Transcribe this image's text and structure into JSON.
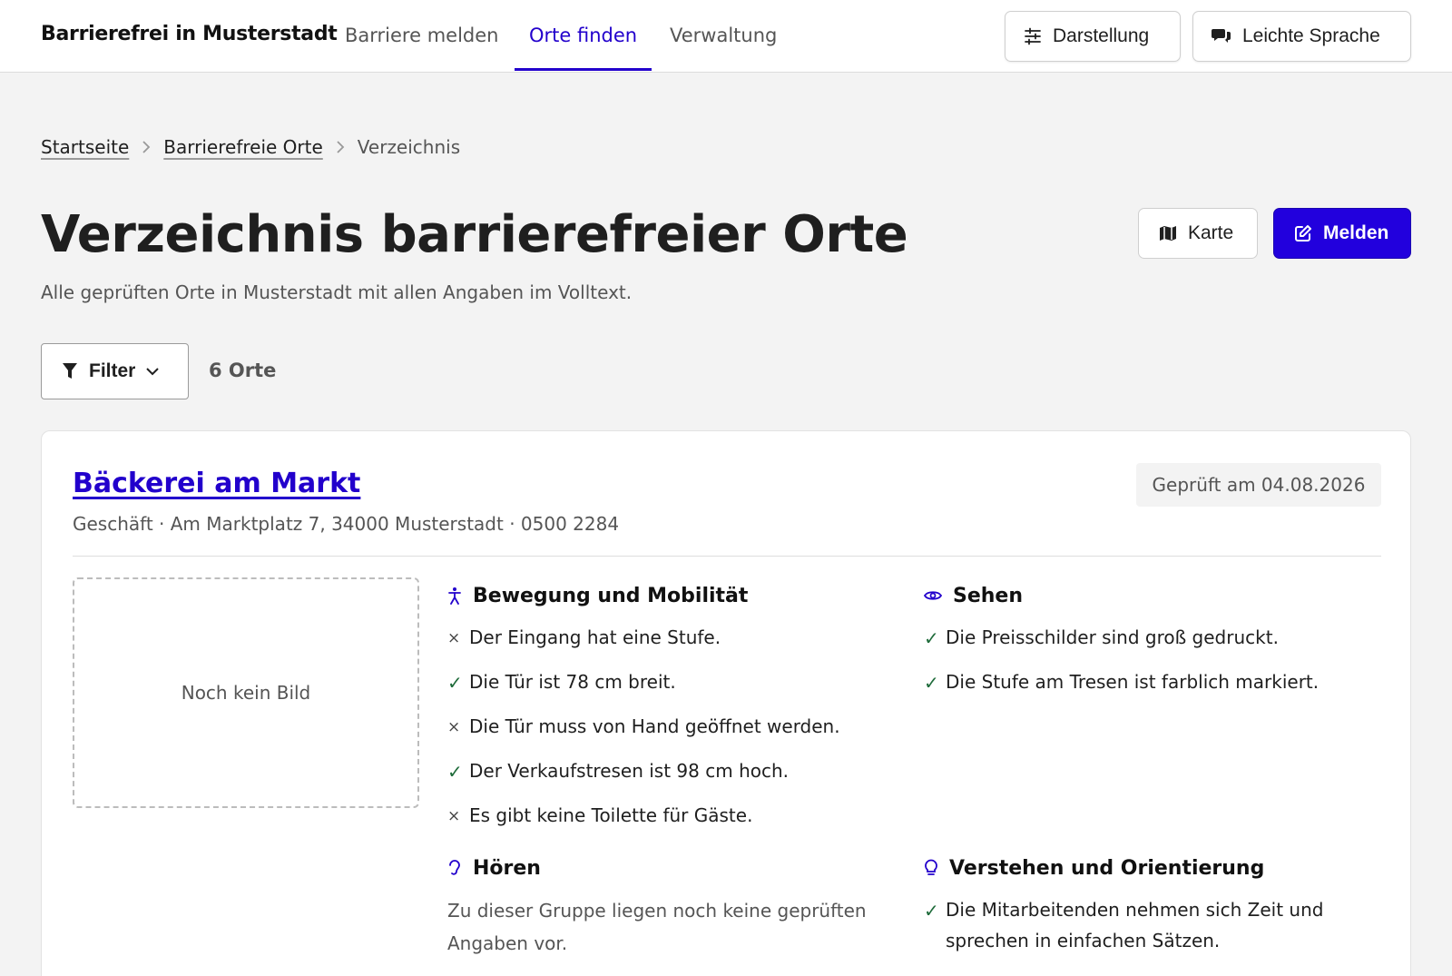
{
  "header": {
    "brand": "Barrierefrei in Musterstadt",
    "nav": [
      "Barriere melden",
      "Orte finden",
      "Verwaltung"
    ],
    "active_nav": "Orte finden",
    "display_button": "Darstellung",
    "easy_language_button": "Leichte Sprache",
    "accent_color": "#2200cc"
  },
  "breadcrumb": {
    "items": [
      "Startseite",
      "Barrierefreie Orte"
    ],
    "current": "Verzeichnis"
  },
  "page": {
    "title": "Verzeichnis barrierefreier Orte",
    "subtitle": "Alle geprüften Orte in Musterstadt mit allen Angaben im Volltext.",
    "map_button": "Karte",
    "report_button": "Melden"
  },
  "filter": {
    "label": "Filter",
    "count": "6 Orte"
  },
  "place": {
    "name": "Bäckerei am Markt",
    "meta": "Geschäft · Am Marktplatz 7, 34000 Musterstadt · 0500 2284",
    "checked": "Geprüft am 04.08.2026",
    "no_image": "Noch kein Bild",
    "groups": [
      {
        "title": "Bewegung und Mobilität",
        "icon": "person-icon",
        "items": [
          {
            "status": "no",
            "text": "Der Eingang hat eine Stufe."
          },
          {
            "status": "ok",
            "text": "Die Tür ist 78 cm breit."
          },
          {
            "status": "no",
            "text": "Die Tür muss von Hand geöffnet werden."
          },
          {
            "status": "ok",
            "text": "Der Verkaufstresen ist 98 cm hoch."
          },
          {
            "status": "no",
            "text": "Es gibt keine Toilette für Gäste."
          }
        ]
      },
      {
        "title": "Sehen",
        "icon": "eye-icon",
        "items": [
          {
            "status": "ok",
            "text": "Die Preisschilder sind groß gedruckt."
          },
          {
            "status": "ok",
            "text": "Die Stufe am Tresen ist farblich markiert."
          }
        ]
      },
      {
        "title": "Hören",
        "icon": "ear-icon",
        "empty": "Zu dieser Gruppe liegen noch keine geprüften Angaben vor."
      },
      {
        "title": "Verstehen und Orientierung",
        "icon": "lightbulb-icon",
        "items": [
          {
            "status": "ok",
            "text": "Die Mitarbeitenden nehmen sich Zeit und sprechen in einfachen Sätzen."
          }
        ]
      }
    ],
    "marks": {
      "ok": "✓",
      "no": "×"
    }
  }
}
